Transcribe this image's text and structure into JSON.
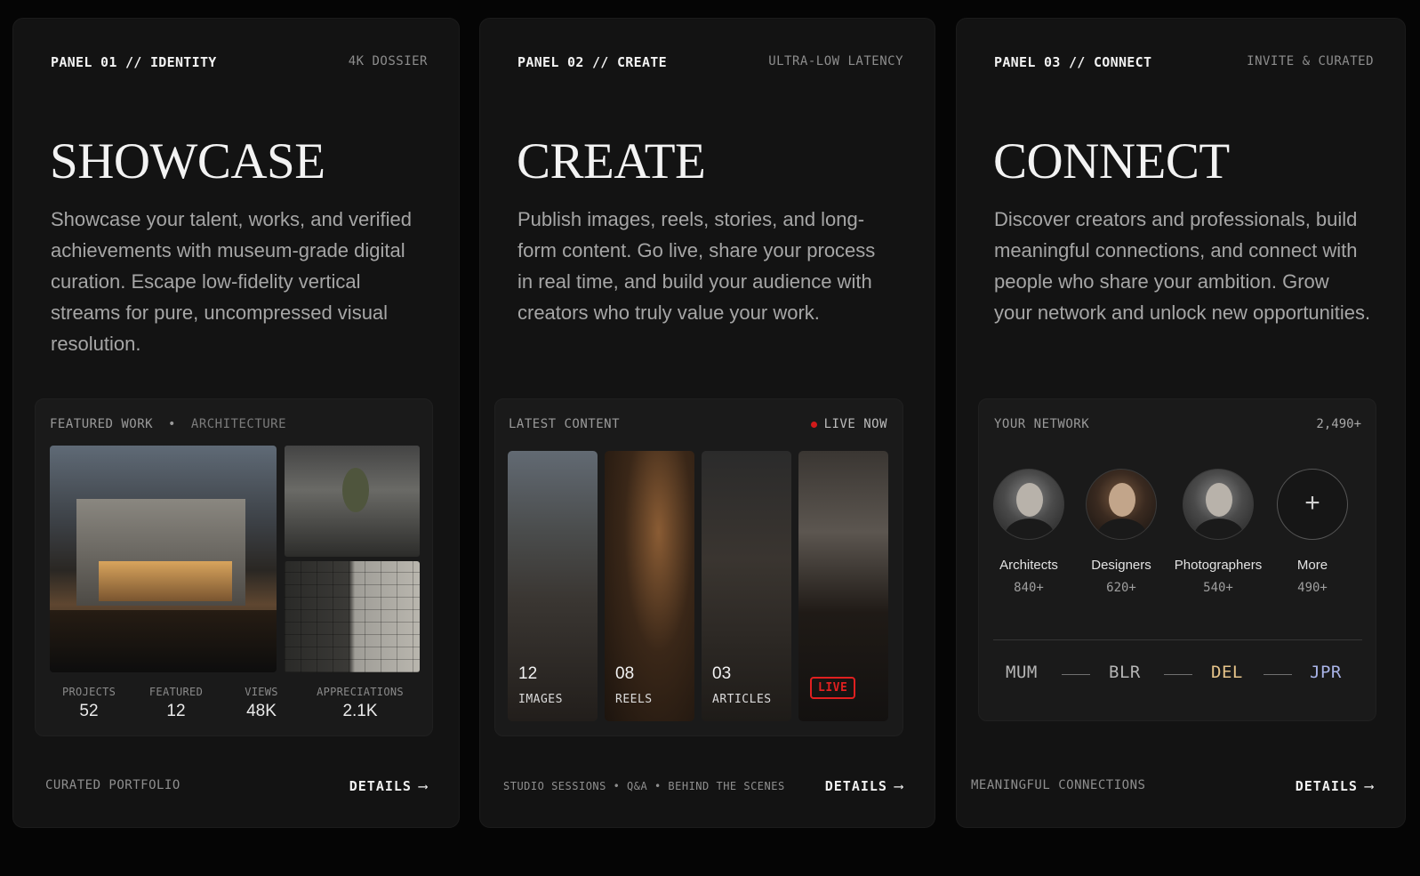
{
  "panels": [
    {
      "label": "PANEL 01 // IDENTITY",
      "tag": "4K DOSSIER",
      "title": "SHOWCASE",
      "description": "Showcase your talent, works, and verified achievements with museum-grade digital curation. Escape low-fidelity vertical streams for pure, uncompressed visual resolution.",
      "card": {
        "heading": "FEATURED WORK",
        "separator": "•",
        "category": "ARCHITECTURE",
        "stats": [
          {
            "label": "PROJECTS",
            "value": "52"
          },
          {
            "label": "FEATURED",
            "value": "12"
          },
          {
            "label": "VIEWS",
            "value": "48K"
          },
          {
            "label": "APPRECIATIONS",
            "value": "2.1K"
          }
        ]
      },
      "footer": "CURATED PORTFOLIO",
      "details": "DETAILS"
    },
    {
      "label": "PANEL 02 // CREATE",
      "tag": "ULTRA-LOW LATENCY",
      "title": "CREATE",
      "description": "Publish images, reels, stories, and long-form content. Go live, share your process in real time, and build your audience with creators who truly value your work.",
      "card": {
        "heading": "LATEST CONTENT",
        "live_now": "LIVE NOW",
        "tiles": [
          {
            "count": "12",
            "label": "IMAGES"
          },
          {
            "count": "08",
            "label": "REELS"
          },
          {
            "count": "03",
            "label": "ARTICLES"
          }
        ],
        "live_badge": "LIVE"
      },
      "footer": "STUDIO SESSIONS • Q&A • BEHIND THE SCENES",
      "details": "DETAILS"
    },
    {
      "label": "PANEL 03 // CONNECT",
      "tag": "INVITE & CURATED",
      "title": "CONNECT",
      "description": "Discover creators and professionals, build meaningful connections, and connect with people who share your ambition. Grow your network and unlock new opportunities.",
      "card": {
        "heading": "YOUR NETWORK",
        "total": "2,490+",
        "people": [
          {
            "name": "Architects",
            "count": "840+"
          },
          {
            "name": "Designers",
            "count": "620+"
          },
          {
            "name": "Photographers",
            "count": "540+"
          },
          {
            "name": "More",
            "count": "490+"
          }
        ],
        "plus_symbol": "+",
        "cities": [
          {
            "name": "MUM",
            "color": "#b5b5b5"
          },
          {
            "name": "BLR",
            "color": "#b5b5b5"
          },
          {
            "name": "DEL",
            "color": "#e6c48a"
          },
          {
            "name": "JPR",
            "color": "#a9b4e8"
          }
        ]
      },
      "footer": "MEANINGFUL CONNECTIONS",
      "details": "DETAILS"
    }
  ],
  "arrow": "⟶"
}
